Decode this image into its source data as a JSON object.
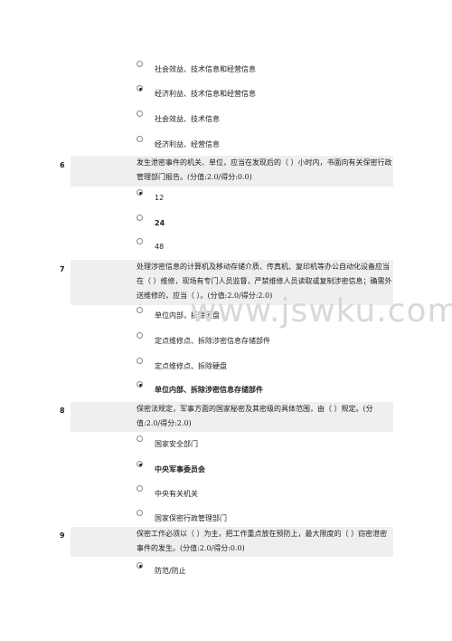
{
  "q5": {
    "options": [
      "社会效益、技术信息和经营信息",
      "经济利益、技术信息和经营信息",
      "社会效益、技术信息",
      "经济利益、经营信息"
    ]
  },
  "q6": {
    "number": "6",
    "text": "发生泄密事件的机关、单位，应当在发现后的（ ）小时内，书面向有关保密行政管理部门报告。(分值:2.0/得分:0.0)",
    "options": [
      "12",
      "24",
      "48"
    ]
  },
  "q7": {
    "number": "7",
    "text": "处理涉密信息的计算机及移动存储介质、传真机、复印机等办公自动化设备应当在（ ）维修，现场有专门人员监督，严禁维修人员读取或复制涉密信息；确需外送维修的，应当（ ）。(分值:2.0/得分:2.0)",
    "options": [
      "单位内部，拆除硬盘",
      "定点维修点、拆除涉密信息存储部件",
      "定点维修点、拆除硬盘",
      "单位内部、拆除涉密信息存储部件"
    ]
  },
  "q8": {
    "number": "8",
    "text": "保密法规定，军事方面的国家秘密及其密级的具体范围，由（ ）规定。(分值:2.0/得分:2.0)",
    "options": [
      "国家安全部门",
      "中央军事委员会",
      "中央有关机关",
      "国家保密行政管理部门"
    ]
  },
  "q9": {
    "number": "9",
    "text": "保密工作必须以（ ）为主，把工作重点放在预防上，最大限度的（ ）窃密泄密事件的发生。(分值:2.0/得分:0.0)",
    "options": [
      "防范/防止"
    ]
  },
  "watermark": "www.jswku.com"
}
